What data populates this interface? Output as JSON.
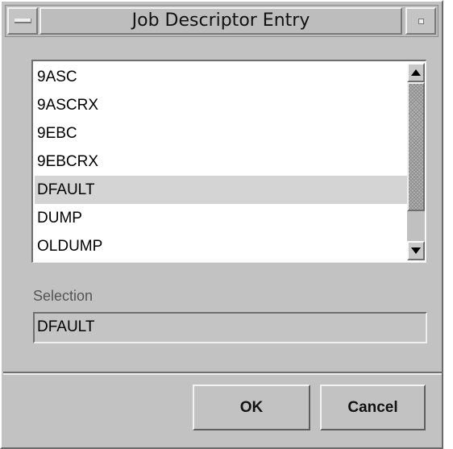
{
  "window": {
    "title": "Job Descriptor Entry"
  },
  "list": {
    "items": [
      "9ASC",
      "9ASCRX",
      "9EBC",
      "9EBCRX",
      "DFAULT",
      "DUMP",
      "OLDUMP"
    ],
    "selected_item": "DFAULT"
  },
  "selection": {
    "label": "Selection",
    "value": "DFAULT"
  },
  "buttons": {
    "ok_label": "OK",
    "cancel_label": "Cancel"
  },
  "colors": {
    "window_bg": "#c2c2c2",
    "list_bg": "#ffffff",
    "selected_row_bg": "#d4d4d4"
  },
  "icons": {
    "window_menu": "window-menu-icon",
    "minimize": "minimize-icon",
    "scroll_up": "scroll-up-arrow-icon",
    "scroll_down": "scroll-down-arrow-icon"
  }
}
